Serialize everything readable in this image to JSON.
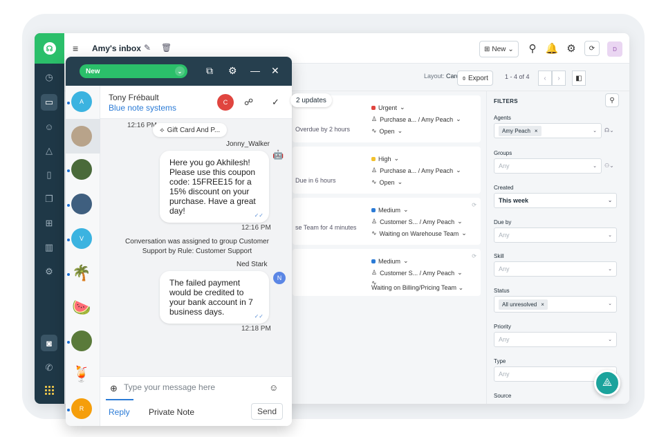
{
  "app": {
    "inbox_title": "Amy's inbox"
  },
  "topbar": {
    "new_label": "New",
    "avatar_initial": "D"
  },
  "toolbar": {
    "layout_label": "Layout:",
    "layout_value": "Card view",
    "export_label": "Export",
    "page_count": "1 - 4 of 4"
  },
  "tickets": {
    "updates_label": "2 updates",
    "cards": [
      {
        "left_text": "Overdue by 2 hours",
        "priority": "Urgent",
        "priority_color": "#e0453f",
        "group": "Purchase a... / Amy Peach",
        "status": "Open"
      },
      {
        "left_text": "Due in 6 hours",
        "priority": "High",
        "priority_color": "#f2c12e",
        "group": "Purchase a... / Amy Peach",
        "status": "Open"
      },
      {
        "left_text": "se Team for 4 minutes",
        "priority": "Medium",
        "priority_color": "#2b7bd6",
        "group": "Customer S... / Amy Peach",
        "status": "Waiting on Warehouse Team"
      },
      {
        "left_text": "",
        "priority": "Medium",
        "priority_color": "#2b7bd6",
        "group": "Customer S... / Amy Peach",
        "status": "Waiting on Billing/Pricing Team"
      }
    ]
  },
  "filters": {
    "title": "FILTERS",
    "agents_label": "Agents",
    "agents_chip": "Amy Peach",
    "groups_label": "Groups",
    "groups_value": "Any",
    "created_label": "Created",
    "created_value": "This week",
    "due_label": "Due by",
    "due_value": "Any",
    "skill_label": "Skill",
    "skill_value": "Any",
    "status_label": "Status",
    "status_chip": "All unresolved",
    "priority_label": "Priority",
    "priority_value": "Any",
    "type_label": "Type",
    "type_value": "Any",
    "source_label": "Source"
  },
  "chat": {
    "status_label": "New",
    "contact": {
      "name": "Tony Frébault",
      "company": "Blue note systems",
      "badge": "C"
    },
    "contacts": [
      {
        "initial": "A",
        "color": "#3bb3e0"
      },
      {
        "initial": "",
        "color": "#b8a38a"
      },
      {
        "initial": "",
        "color": "#4a6a3a"
      },
      {
        "initial": "",
        "color": "#3f5f7f"
      },
      {
        "initial": "V",
        "color": "#3bb3e0"
      },
      {
        "initial": "🌴",
        "color": "#f7f8f9"
      },
      {
        "initial": "🍉",
        "color": "#f7f8f9"
      },
      {
        "initial": "",
        "color": "#5a7a3a"
      },
      {
        "initial": "🍹",
        "color": "#f7f8f9"
      },
      {
        "initial": "R",
        "color": "#f59e0b"
      }
    ],
    "messages": {
      "time1": "12:16 PM",
      "gift_label": "Gift Card And P...",
      "sender1": "Jonny_Walker",
      "bubble1": "Here you go Akhilesh! Please use this coupon code: 15FREE15 for a 15% discount on your purchase. Have a great day!",
      "time2": "12:16 PM",
      "system_message": "Conversation was assigned to group Customer Support by Rule: Customer Support",
      "sender2": "Ned Stark",
      "sender2_badge": "N",
      "bubble2": "The failed payment would be credited to your bank account in 7 business days.",
      "time3": "12:18 PM"
    },
    "composer": {
      "placeholder": "Type your message here",
      "reply_tab": "Reply",
      "note_tab": "Private Note",
      "send_label": "Send"
    }
  }
}
